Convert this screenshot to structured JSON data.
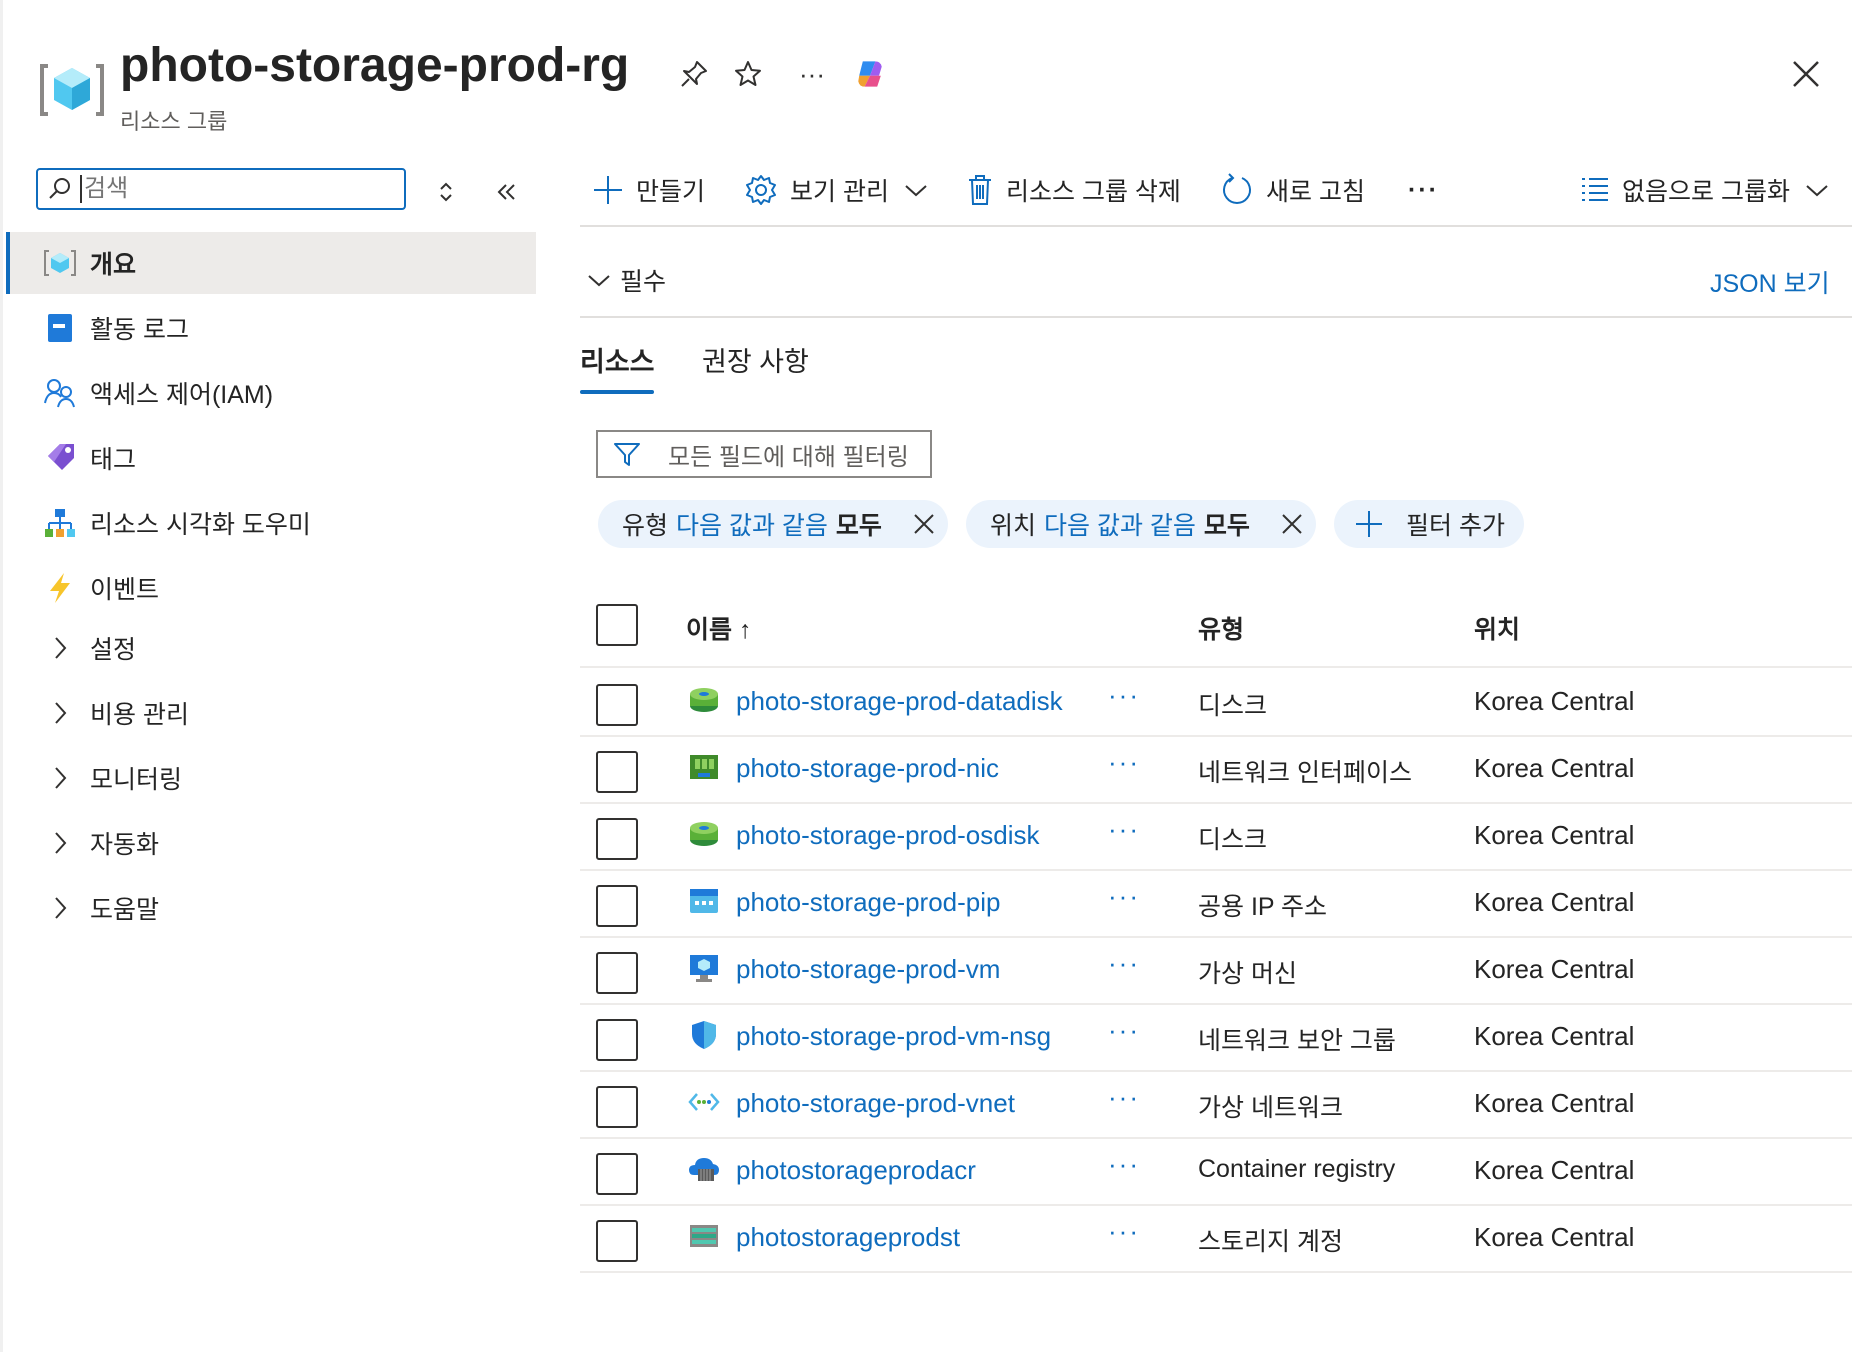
{
  "header": {
    "title": "photo-storage-prod-rg",
    "subtitle": "리소스 그룹"
  },
  "sidebar": {
    "search_value": "검색",
    "items": [
      {
        "label": "개요",
        "icon": "resource-group-icon",
        "active": true
      },
      {
        "label": "활동 로그",
        "icon": "activity-log-icon"
      },
      {
        "label": "액세스 제어(IAM)",
        "icon": "iam-icon"
      },
      {
        "label": "태그",
        "icon": "tag-icon"
      },
      {
        "label": "리소스 시각화 도우미",
        "icon": "visualizer-icon"
      },
      {
        "label": "이벤트",
        "icon": "events-icon"
      },
      {
        "label": "설정",
        "icon": "chevron-right-icon"
      },
      {
        "label": "비용 관리",
        "icon": "chevron-right-icon"
      },
      {
        "label": "모니터링",
        "icon": "chevron-right-icon"
      },
      {
        "label": "자동화",
        "icon": "chevron-right-icon"
      },
      {
        "label": "도움말",
        "icon": "chevron-right-icon"
      }
    ]
  },
  "toolbar": {
    "create": "만들기",
    "manage_view": "보기 관리",
    "delete_rg": "리소스 그룹 삭제",
    "refresh": "새로 고침",
    "more": "···",
    "group_by": "없음으로 그룹화"
  },
  "essentials": {
    "label": "필수",
    "json_view": "JSON 보기"
  },
  "tabs": [
    "리소스",
    "권장 사항"
  ],
  "filters": {
    "placeholder": "모든 필드에 대해 필터링",
    "pills": [
      {
        "key": "유형",
        "op": "다음 값과 같음",
        "value": "모두"
      },
      {
        "key": "위치",
        "op": "다음 값과 같음",
        "value": "모두"
      }
    ],
    "add_filter": "필터 추가"
  },
  "table": {
    "columns": {
      "name": "이름 ↑",
      "type": "유형",
      "location": "위치"
    },
    "rows": [
      {
        "name": "photo-storage-prod-datadisk",
        "type": "디스크",
        "location": "Korea Central",
        "icon": "disk-icon"
      },
      {
        "name": "photo-storage-prod-nic",
        "type": "네트워크 인터페이스",
        "location": "Korea Central",
        "icon": "nic-icon"
      },
      {
        "name": "photo-storage-prod-osdisk",
        "type": "디스크",
        "location": "Korea Central",
        "icon": "disk-icon"
      },
      {
        "name": "photo-storage-prod-pip",
        "type": "공용 IP 주소",
        "location": "Korea Central",
        "icon": "public-ip-icon"
      },
      {
        "name": "photo-storage-prod-vm",
        "type": "가상 머신",
        "location": "Korea Central",
        "icon": "vm-icon"
      },
      {
        "name": "photo-storage-prod-vm-nsg",
        "type": "네트워크 보안 그룹",
        "location": "Korea Central",
        "icon": "nsg-icon"
      },
      {
        "name": "photo-storage-prod-vnet",
        "type": "가상 네트워크",
        "location": "Korea Central",
        "icon": "vnet-icon"
      },
      {
        "name": "photostorageprodacr",
        "type": "Container registry",
        "location": "Korea Central",
        "icon": "container-registry-icon"
      },
      {
        "name": "photostorageprodst",
        "type": "스토리지 계정",
        "location": "Korea Central",
        "icon": "storage-account-icon"
      }
    ],
    "row_more": "···"
  },
  "colors": {
    "accent": "#0f6cbd",
    "link": "#0f6cbd",
    "pill_bg": "#ebf3fc",
    "active_nav_bg": "#edebe9"
  }
}
